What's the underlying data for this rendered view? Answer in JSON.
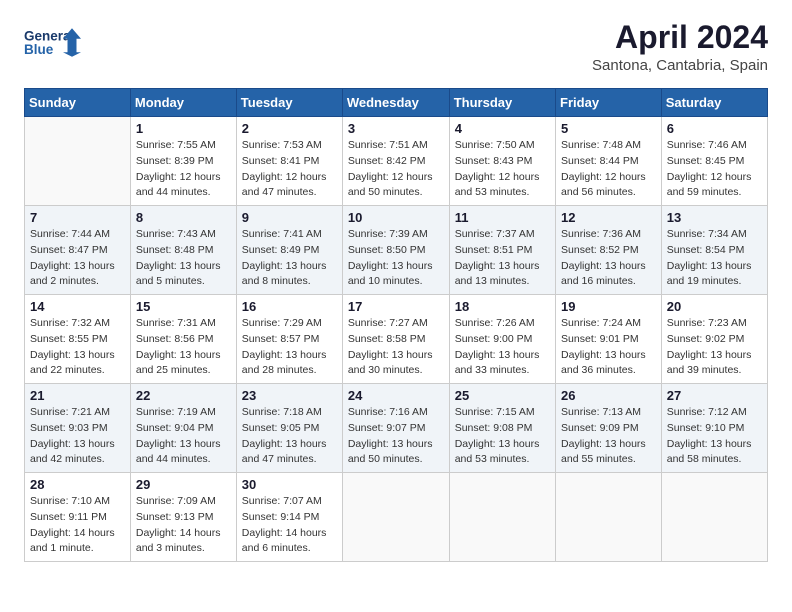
{
  "header": {
    "logo_line1": "General",
    "logo_line2": "Blue",
    "month": "April 2024",
    "location": "Santona, Cantabria, Spain"
  },
  "weekdays": [
    "Sunday",
    "Monday",
    "Tuesday",
    "Wednesday",
    "Thursday",
    "Friday",
    "Saturday"
  ],
  "weeks": [
    [
      {
        "day": "",
        "info": ""
      },
      {
        "day": "1",
        "info": "Sunrise: 7:55 AM\nSunset: 8:39 PM\nDaylight: 12 hours\nand 44 minutes."
      },
      {
        "day": "2",
        "info": "Sunrise: 7:53 AM\nSunset: 8:41 PM\nDaylight: 12 hours\nand 47 minutes."
      },
      {
        "day": "3",
        "info": "Sunrise: 7:51 AM\nSunset: 8:42 PM\nDaylight: 12 hours\nand 50 minutes."
      },
      {
        "day": "4",
        "info": "Sunrise: 7:50 AM\nSunset: 8:43 PM\nDaylight: 12 hours\nand 53 minutes."
      },
      {
        "day": "5",
        "info": "Sunrise: 7:48 AM\nSunset: 8:44 PM\nDaylight: 12 hours\nand 56 minutes."
      },
      {
        "day": "6",
        "info": "Sunrise: 7:46 AM\nSunset: 8:45 PM\nDaylight: 12 hours\nand 59 minutes."
      }
    ],
    [
      {
        "day": "7",
        "info": "Sunrise: 7:44 AM\nSunset: 8:47 PM\nDaylight: 13 hours\nand 2 minutes."
      },
      {
        "day": "8",
        "info": "Sunrise: 7:43 AM\nSunset: 8:48 PM\nDaylight: 13 hours\nand 5 minutes."
      },
      {
        "day": "9",
        "info": "Sunrise: 7:41 AM\nSunset: 8:49 PM\nDaylight: 13 hours\nand 8 minutes."
      },
      {
        "day": "10",
        "info": "Sunrise: 7:39 AM\nSunset: 8:50 PM\nDaylight: 13 hours\nand 10 minutes."
      },
      {
        "day": "11",
        "info": "Sunrise: 7:37 AM\nSunset: 8:51 PM\nDaylight: 13 hours\nand 13 minutes."
      },
      {
        "day": "12",
        "info": "Sunrise: 7:36 AM\nSunset: 8:52 PM\nDaylight: 13 hours\nand 16 minutes."
      },
      {
        "day": "13",
        "info": "Sunrise: 7:34 AM\nSunset: 8:54 PM\nDaylight: 13 hours\nand 19 minutes."
      }
    ],
    [
      {
        "day": "14",
        "info": "Sunrise: 7:32 AM\nSunset: 8:55 PM\nDaylight: 13 hours\nand 22 minutes."
      },
      {
        "day": "15",
        "info": "Sunrise: 7:31 AM\nSunset: 8:56 PM\nDaylight: 13 hours\nand 25 minutes."
      },
      {
        "day": "16",
        "info": "Sunrise: 7:29 AM\nSunset: 8:57 PM\nDaylight: 13 hours\nand 28 minutes."
      },
      {
        "day": "17",
        "info": "Sunrise: 7:27 AM\nSunset: 8:58 PM\nDaylight: 13 hours\nand 30 minutes."
      },
      {
        "day": "18",
        "info": "Sunrise: 7:26 AM\nSunset: 9:00 PM\nDaylight: 13 hours\nand 33 minutes."
      },
      {
        "day": "19",
        "info": "Sunrise: 7:24 AM\nSunset: 9:01 PM\nDaylight: 13 hours\nand 36 minutes."
      },
      {
        "day": "20",
        "info": "Sunrise: 7:23 AM\nSunset: 9:02 PM\nDaylight: 13 hours\nand 39 minutes."
      }
    ],
    [
      {
        "day": "21",
        "info": "Sunrise: 7:21 AM\nSunset: 9:03 PM\nDaylight: 13 hours\nand 42 minutes."
      },
      {
        "day": "22",
        "info": "Sunrise: 7:19 AM\nSunset: 9:04 PM\nDaylight: 13 hours\nand 44 minutes."
      },
      {
        "day": "23",
        "info": "Sunrise: 7:18 AM\nSunset: 9:05 PM\nDaylight: 13 hours\nand 47 minutes."
      },
      {
        "day": "24",
        "info": "Sunrise: 7:16 AM\nSunset: 9:07 PM\nDaylight: 13 hours\nand 50 minutes."
      },
      {
        "day": "25",
        "info": "Sunrise: 7:15 AM\nSunset: 9:08 PM\nDaylight: 13 hours\nand 53 minutes."
      },
      {
        "day": "26",
        "info": "Sunrise: 7:13 AM\nSunset: 9:09 PM\nDaylight: 13 hours\nand 55 minutes."
      },
      {
        "day": "27",
        "info": "Sunrise: 7:12 AM\nSunset: 9:10 PM\nDaylight: 13 hours\nand 58 minutes."
      }
    ],
    [
      {
        "day": "28",
        "info": "Sunrise: 7:10 AM\nSunset: 9:11 PM\nDaylight: 14 hours\nand 1 minute."
      },
      {
        "day": "29",
        "info": "Sunrise: 7:09 AM\nSunset: 9:13 PM\nDaylight: 14 hours\nand 3 minutes."
      },
      {
        "day": "30",
        "info": "Sunrise: 7:07 AM\nSunset: 9:14 PM\nDaylight: 14 hours\nand 6 minutes."
      },
      {
        "day": "",
        "info": ""
      },
      {
        "day": "",
        "info": ""
      },
      {
        "day": "",
        "info": ""
      },
      {
        "day": "",
        "info": ""
      }
    ]
  ]
}
